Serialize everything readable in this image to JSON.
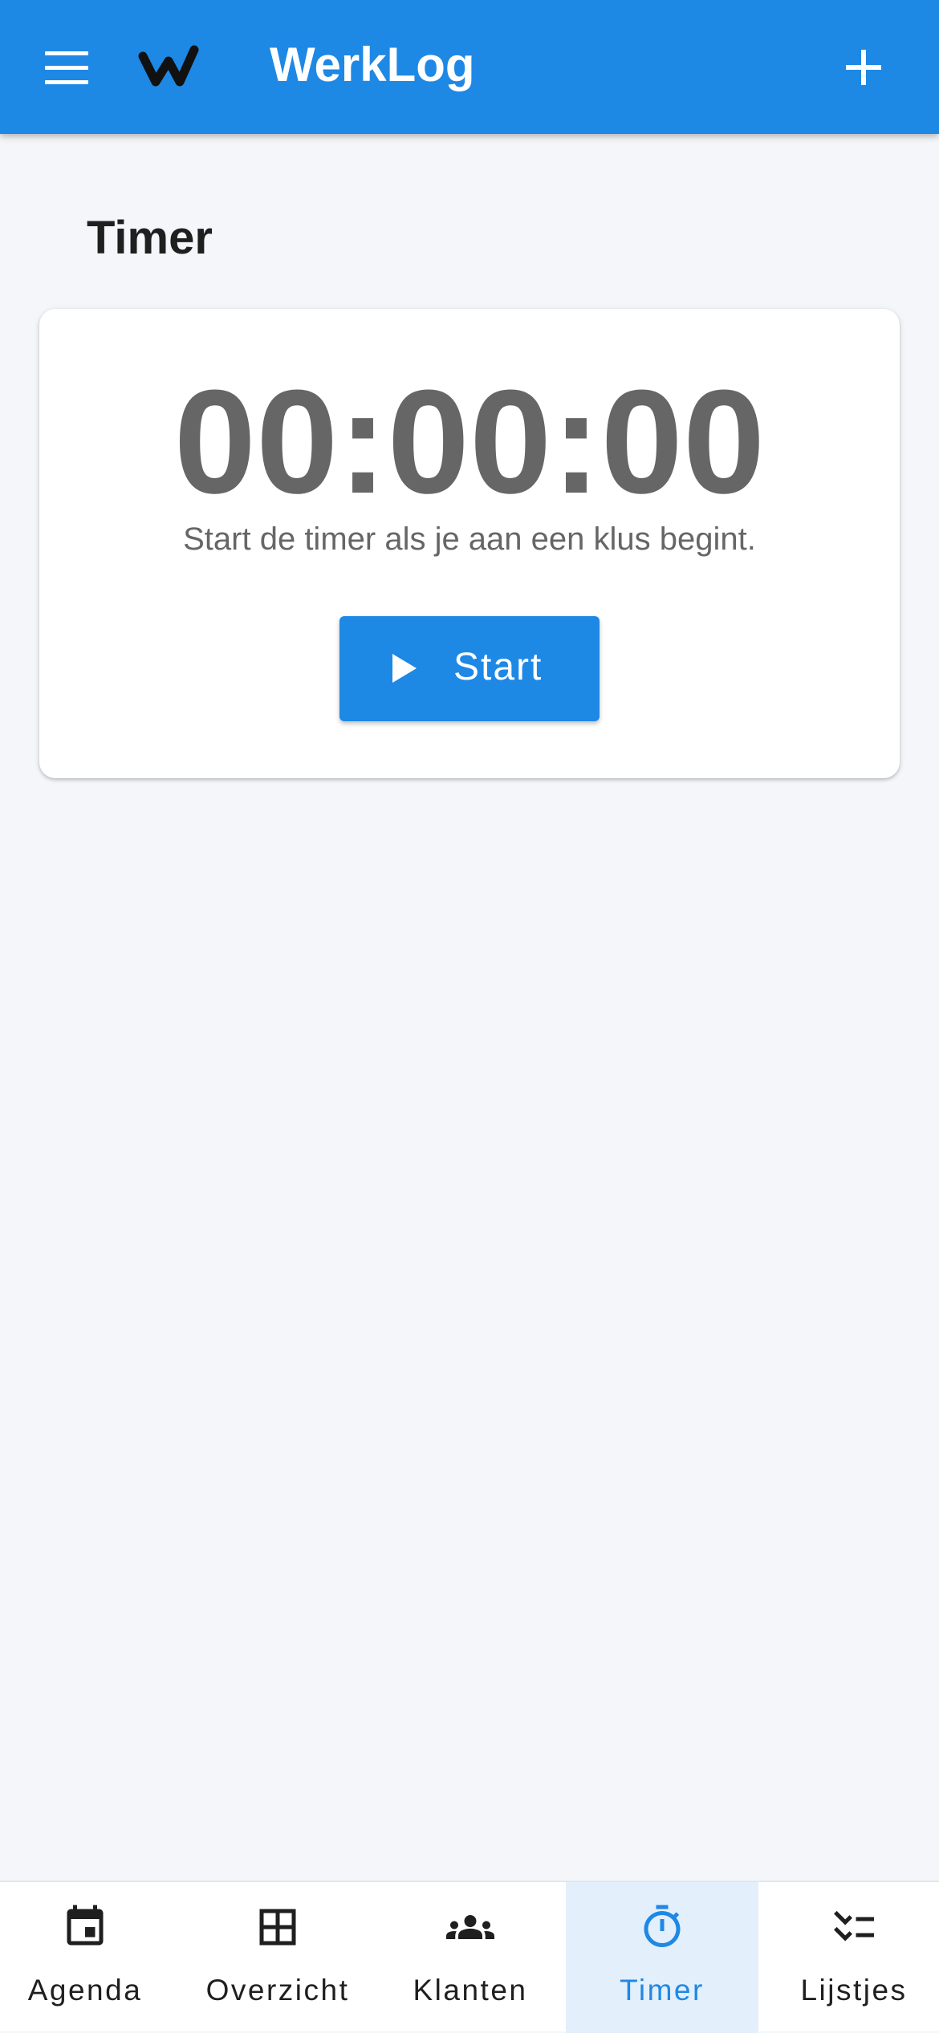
{
  "app": {
    "title": "WerkLog",
    "logo_icon": "werklog-w-logo",
    "menu_icon": "hamburger-menu-icon",
    "add_icon": "plus-icon"
  },
  "page": {
    "title": "Timer"
  },
  "timer": {
    "display": "00:00:00",
    "hint": "Start de timer als je aan een klus begint.",
    "start_label": "Start",
    "start_icon": "play-icon"
  },
  "nav": {
    "items": [
      {
        "label": "Agenda",
        "icon": "calendar-icon"
      },
      {
        "label": "Overzicht",
        "icon": "table-icon"
      },
      {
        "label": "Klanten",
        "icon": "people-icon"
      },
      {
        "label": "Timer",
        "icon": "stopwatch-icon",
        "active": true
      },
      {
        "label": "Lijstjes",
        "icon": "checklist-icon"
      }
    ]
  },
  "colors": {
    "primary": "#1e88e5",
    "background": "#f4f6fa",
    "active_nav_background": "#e3effb",
    "timer_text": "#666666"
  }
}
